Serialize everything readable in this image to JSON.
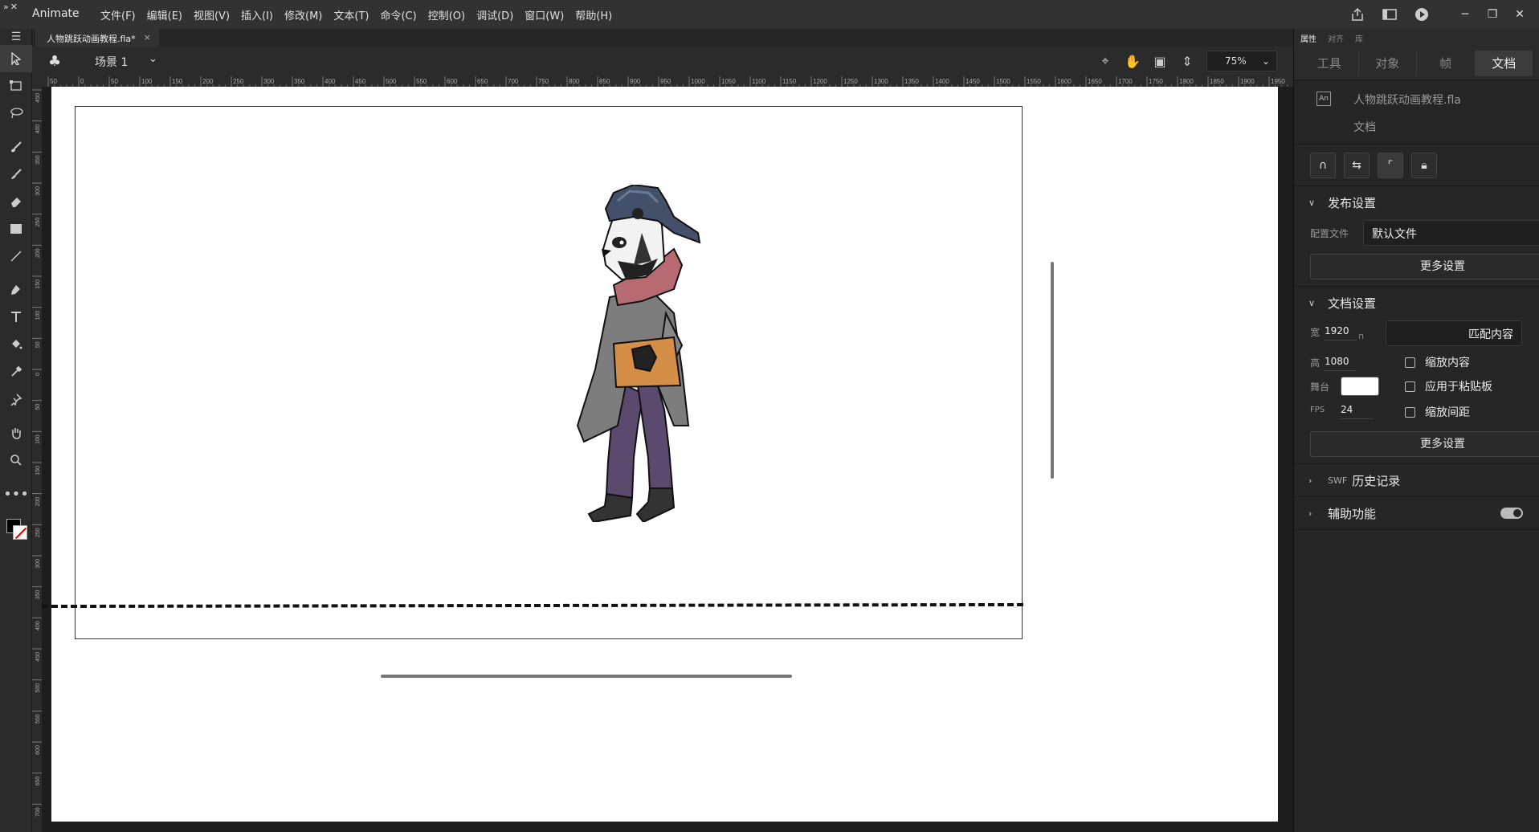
{
  "app": {
    "name": "Animate",
    "menus": [
      "文件(F)",
      "编辑(E)",
      "视图(V)",
      "插入(I)",
      "修改(M)",
      "文本(T)",
      "命令(C)",
      "控制(O)",
      "调试(D)",
      "窗口(W)",
      "帮助(H)"
    ],
    "window_controls": [
      "─",
      "❐",
      "✕"
    ]
  },
  "document": {
    "tab_title": "人物跳跃动画教程.fla*",
    "tab_close": "×"
  },
  "scene_bar": {
    "scene_name": "场景 1",
    "zoom": "75%"
  },
  "ruler": {
    "h_ticks": [
      "50",
      "0",
      "50",
      "100",
      "150",
      "200",
      "250",
      "300",
      "350",
      "400",
      "450",
      "500",
      "550",
      "600",
      "650",
      "700",
      "750",
      "800",
      "850",
      "900",
      "950",
      "1000",
      "1050",
      "1100",
      "1150",
      "1200",
      "1250",
      "1300",
      "1350",
      "1400",
      "1450",
      "1500",
      "1550",
      "1600",
      "1650",
      "1700",
      "1750",
      "1800",
      "1850",
      "1900",
      "1950"
    ],
    "v_ticks": [
      "450",
      "400",
      "350",
      "300",
      "250",
      "200",
      "150",
      "100",
      "50",
      "0",
      "50",
      "100",
      "150",
      "200",
      "250",
      "300",
      "350",
      "400",
      "450",
      "500",
      "550",
      "600",
      "650",
      "700"
    ]
  },
  "right_panel": {
    "top_tabs": [
      "属性",
      "对齐",
      "库"
    ],
    "tabs": [
      "工具",
      "对象",
      "帧",
      "文档"
    ],
    "active_tab": "文档",
    "doc_icon_text": "An",
    "file_name": "人物跳跃动画教程.fla",
    "doc_type": "文档",
    "publish": {
      "title": "发布设置",
      "profile_label": "配置文件",
      "profile_value": "默认文件",
      "more_btn": "更多设置"
    },
    "doc_settings": {
      "title": "文档设置",
      "width_label": "宽",
      "width_value": "1920",
      "height_label": "高",
      "height_value": "1080",
      "match_btn": "匹配内容",
      "stage_label": "舞台",
      "fps_label": "FPS",
      "fps_value": "24",
      "scale_content": "缩放内容",
      "apply_pasteboard": "应用于粘贴板",
      "scale_spacing": "缩放间距",
      "more_btn": "更多设置",
      "stage_color": "#ffffff"
    },
    "swf_history": {
      "tag": "SWF",
      "title": "历史记录"
    },
    "accessibility": {
      "title": "辅助功能"
    }
  }
}
